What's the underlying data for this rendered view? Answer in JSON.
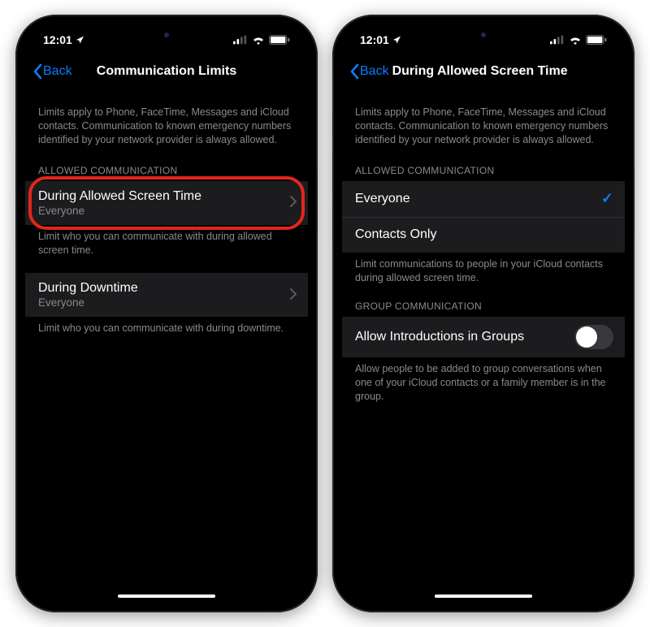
{
  "status": {
    "time": "12:01",
    "location_icon": "location-arrow"
  },
  "phone1": {
    "back_label": "Back",
    "title": "Communication Limits",
    "intro": "Limits apply to Phone, FaceTime, Messages and iCloud contacts. Communication to known emergency numbers identified by your network provider is always allowed.",
    "section_header": "ALLOWED COMMUNICATION",
    "row1_title": "During Allowed Screen Time",
    "row1_sub": "Everyone",
    "row1_footer": "Limit who you can communicate with during allowed screen time.",
    "row2_title": "During Downtime",
    "row2_sub": "Everyone",
    "row2_footer": "Limit who you can communicate with during downtime."
  },
  "phone2": {
    "back_label": "Back",
    "title": "During Allowed Screen Time",
    "intro": "Limits apply to Phone, FaceTime, Messages and iCloud contacts. Communication to known emergency numbers identified by your network provider is always allowed.",
    "section1_header": "ALLOWED COMMUNICATION",
    "opt1": "Everyone",
    "opt2": "Contacts Only",
    "section1_footer": "Limit communications to people in your iCloud contacts during allowed screen time.",
    "section2_header": "GROUP COMMUNICATION",
    "toggle_label": "Allow Introductions in Groups",
    "toggle_state": false,
    "section2_footer": "Allow people to be added to group conversations when one of your iCloud contacts or a family member is in the group."
  }
}
